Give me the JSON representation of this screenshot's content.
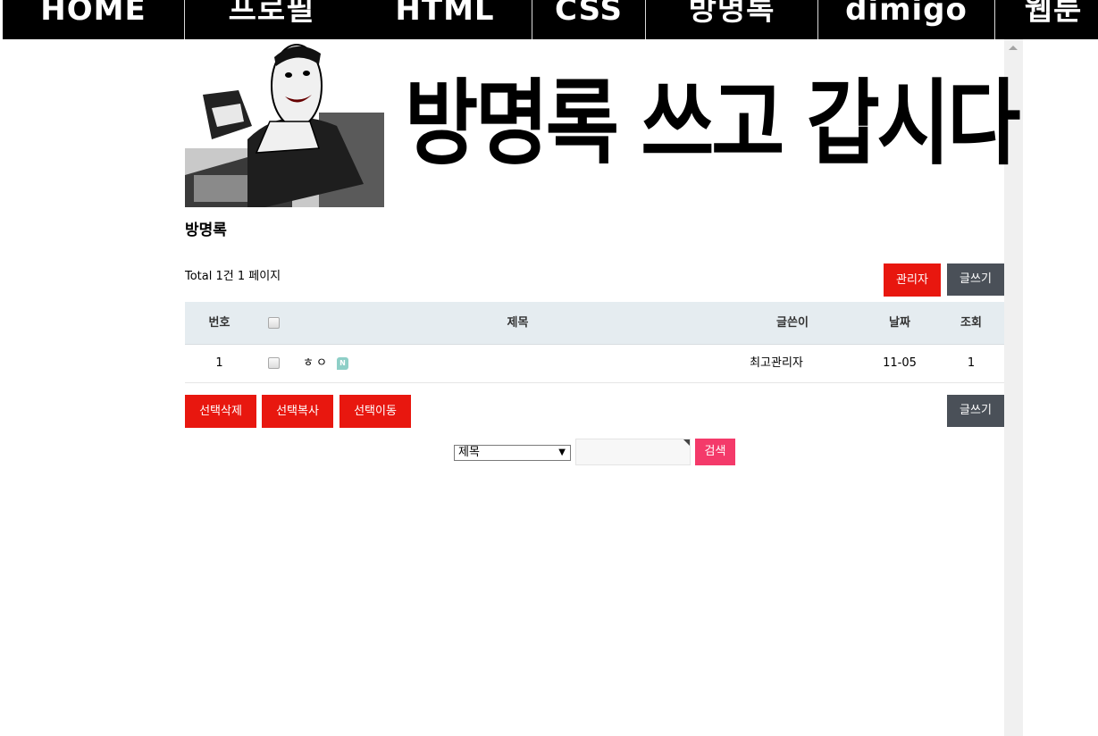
{
  "nav": {
    "items": [
      "HOME",
      "프로필",
      "HTML",
      "CSS",
      "방명록",
      "dimigo",
      "웹툰"
    ]
  },
  "banner": {
    "text": "방명록 쓰고 갑시다"
  },
  "board": {
    "title": "방명록",
    "total_info": "Total 1건 1 페이지",
    "admin_button": "관리자",
    "write_button": "글쓰기"
  },
  "table": {
    "headers": {
      "num": "번호",
      "subject": "제목",
      "writer": "글쓴이",
      "date": "날짜",
      "hit": "조회"
    },
    "rows": [
      {
        "num": "1",
        "subject": "ㅎㅇ",
        "new_badge": "N",
        "writer": "최고관리자",
        "date": "11-05",
        "hit": "1"
      }
    ]
  },
  "actions": {
    "delete_selected": "선택삭제",
    "copy_selected": "선택복사",
    "move_selected": "선택이동",
    "write": "글쓰기"
  },
  "search": {
    "field_selected": "제목",
    "query_value": "",
    "submit": "검색"
  },
  "colors": {
    "nav_bg": "#000000",
    "accent_red": "#e8170f",
    "dark_button": "#4a5058",
    "search_button": "#f43a6a",
    "table_header_bg": "#e5ecf0",
    "new_badge": "#8ecfc7"
  }
}
